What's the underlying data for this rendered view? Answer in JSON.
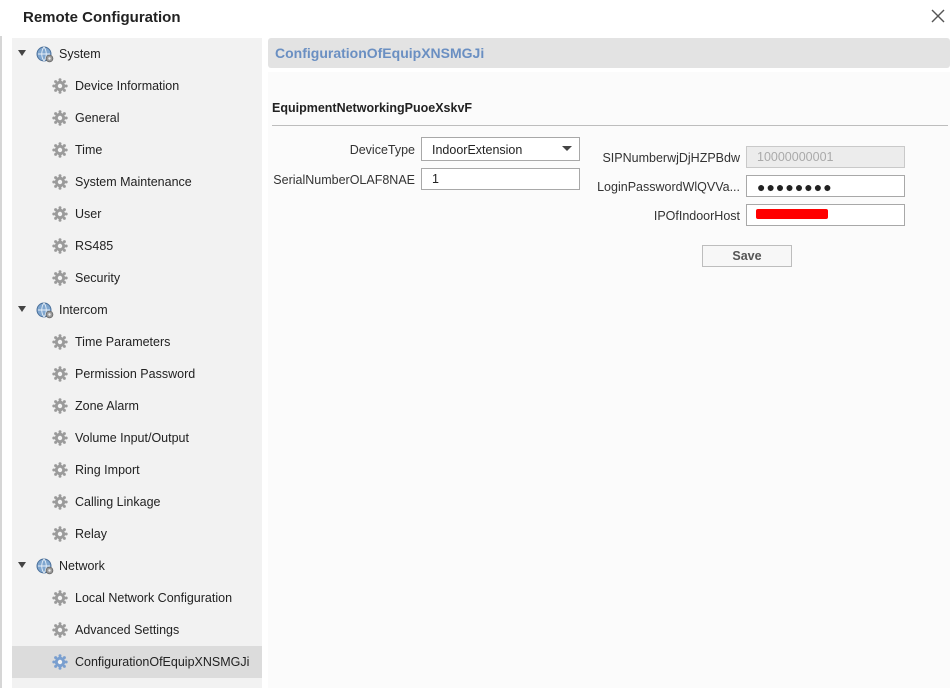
{
  "window": {
    "title": "Remote Configuration"
  },
  "sidebar": {
    "groups": [
      {
        "label": "System",
        "items": [
          "Device Information",
          "General",
          "Time",
          "System Maintenance",
          "User",
          "RS485",
          "Security"
        ]
      },
      {
        "label": "Intercom",
        "items": [
          "Time Parameters",
          "Permission Password",
          "Zone Alarm",
          "Volume Input/Output",
          "Ring Import",
          "Calling Linkage",
          "Relay"
        ]
      },
      {
        "label": "Network",
        "items": [
          "Local Network Configuration",
          "Advanced Settings",
          "ConfigurationOfEquipXNSMGJi"
        ]
      }
    ],
    "selected_item": "ConfigurationOfEquipXNSMGJi"
  },
  "content": {
    "header_title": "ConfigurationOfEquipXNSMGJi",
    "section_title": "EquipmentNetworkingPuoeXskvF",
    "fields": {
      "device_type": {
        "label": "DeviceType",
        "value": "IndoorExtension"
      },
      "serial_number": {
        "label": "SerialNumberOLAF8NAE",
        "value": "1"
      },
      "sip_number": {
        "label": "SIPNumberwjDjHZPBdw",
        "value": "10000000001"
      },
      "login_password": {
        "label": "LoginPasswordWlQVVa...",
        "value": "●●●●●●●●"
      },
      "ip_of_indoor_host": {
        "label": "IPOfIndoorHost",
        "value": ""
      }
    },
    "save_label": "Save"
  },
  "colors": {
    "header_title": "#6a8fc2",
    "sidebar_bg": "#f2f2f2",
    "selected_bg": "#dcdcdc",
    "redaction": "#ff0000"
  },
  "icons": {
    "close": "close-icon",
    "group": "globe-gear-icon",
    "item": "gear-icon",
    "expand": "caret-down-icon"
  }
}
